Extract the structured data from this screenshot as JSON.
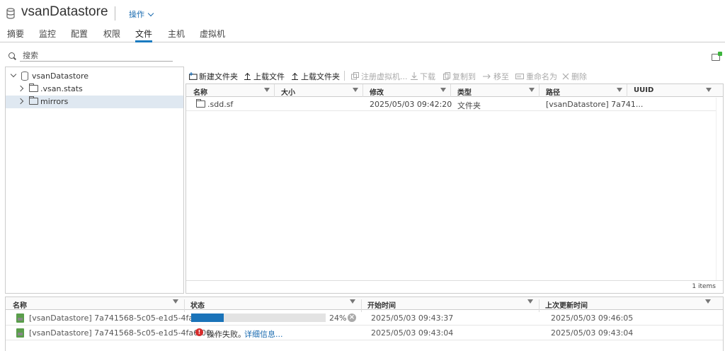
{
  "header": {
    "title": "vsanDatastore",
    "actions_label": "操作"
  },
  "tabs": [
    {
      "label": "摘要",
      "active": false
    },
    {
      "label": "监控",
      "active": false
    },
    {
      "label": "配置",
      "active": false
    },
    {
      "label": "权限",
      "active": false
    },
    {
      "label": "文件",
      "active": true
    },
    {
      "label": "主机",
      "active": false
    },
    {
      "label": "虚拟机",
      "active": false
    }
  ],
  "search": {
    "placeholder": "搜索"
  },
  "tree": {
    "root": "vsanDatastore",
    "children": [
      {
        "label": ".vsan.stats",
        "selected": false
      },
      {
        "label": "mirrors",
        "selected": true
      }
    ]
  },
  "toolbar": {
    "new_folder": "新建文件夹",
    "upload_file": "上载文件",
    "upload_folder": "上载文件夹",
    "register_vm": "注册虚拟机...",
    "download": "下载",
    "copy_to": "复制到",
    "move_to": "移至",
    "rename": "重命名为",
    "delete": "删除"
  },
  "file_grid": {
    "columns": [
      "名称",
      "大小",
      "修改",
      "类型",
      "路径",
      "UUID"
    ],
    "rows": [
      {
        "name": ".sdd.sf",
        "size": "",
        "modified": "2025/05/03 09:42:20",
        "type": "文件夹",
        "path": "[vsanDatastore] 7a741...",
        "uuid": ""
      }
    ],
    "footer": "1 items"
  },
  "tasks": {
    "columns": [
      "名称",
      "状态",
      "开始时间",
      "上次更新时间"
    ],
    "rows": [
      {
        "name": "[vsanDatastore] 7a741568-5c05-e1d5-4fa6-00...",
        "progress": 24,
        "progress_label": "24%",
        "start": "2025/05/03 09:43:37",
        "updated": "2025/05/03 09:46:05"
      },
      {
        "name": "[vsanDatastore] 7a741568-5c05-e1d5-4fa6-00...",
        "status": "操作失败。",
        "details": "详细信息...",
        "start": "2025/05/03 09:43:04",
        "updated": "2025/05/03 09:43:04"
      }
    ]
  },
  "colors": {
    "accent": "#1a7bc0",
    "progress": "#1a73b9",
    "error": "#d62b2b",
    "selected_row": "#dfe8f1"
  }
}
